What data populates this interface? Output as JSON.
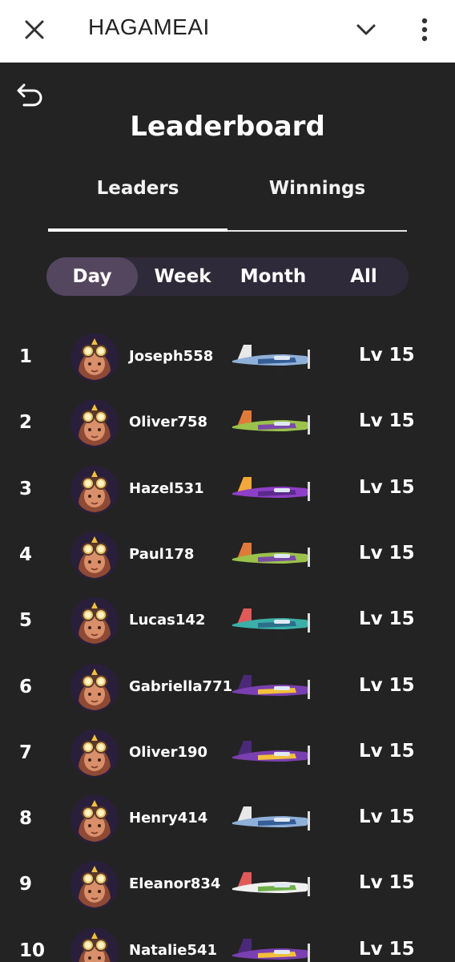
{
  "app_bar": {
    "title": "HAGAMEAI",
    "icons": {
      "close": "close-icon",
      "collapse": "chevron-down-icon",
      "more": "more-vertical-icon"
    }
  },
  "screen": {
    "back_icon": "back-arrow-icon",
    "title": "Leaderboard",
    "tabs": [
      {
        "label": "Leaders",
        "active": true
      },
      {
        "label": "Winnings",
        "active": false
      }
    ],
    "periods": [
      {
        "label": "Day",
        "active": true
      },
      {
        "label": "Week",
        "active": false
      },
      {
        "label": "Month",
        "active": false
      },
      {
        "label": "All",
        "active": false
      }
    ]
  },
  "colors": {
    "background": "#232323",
    "app_bar": "#ffffff",
    "period_bar": "#2f2a3a",
    "period_active": "#54465f"
  },
  "leaders": [
    {
      "rank": "1",
      "name": "Joseph558",
      "level": "Lv 15",
      "plane": "blue-biplane",
      "plane_colors": [
        "#8fb0d8",
        "#355d96",
        "#e8e8e8"
      ]
    },
    {
      "rank": "2",
      "name": "Oliver758",
      "level": "Lv 15",
      "plane": "green-purple-plane",
      "plane_colors": [
        "#9bc24a",
        "#7b4aa8",
        "#e07a3a"
      ]
    },
    {
      "rank": "3",
      "name": "Hazel531",
      "level": "Lv 15",
      "plane": "purple-jet",
      "plane_colors": [
        "#8e3fc7",
        "#5a2a8c",
        "#f2a83a"
      ]
    },
    {
      "rank": "4",
      "name": "Paul178",
      "level": "Lv 15",
      "plane": "green-purple-plane",
      "plane_colors": [
        "#9bc24a",
        "#7b4aa8",
        "#e07a3a"
      ]
    },
    {
      "rank": "5",
      "name": "Lucas142",
      "level": "Lv 15",
      "plane": "teal-biplane",
      "plane_colors": [
        "#3ab0a8",
        "#2b6e8a",
        "#e05a5a"
      ]
    },
    {
      "rank": "6",
      "name": "Gabriella771",
      "level": "Lv 15",
      "plane": "purple-yellow-plane",
      "plane_colors": [
        "#7a3fb0",
        "#f2c03a",
        "#4a2a78"
      ]
    },
    {
      "rank": "7",
      "name": "Oliver190",
      "level": "Lv 15",
      "plane": "purple-yellow-plane",
      "plane_colors": [
        "#7a3fb0",
        "#f2c03a",
        "#4a2a78"
      ]
    },
    {
      "rank": "8",
      "name": "Henry414",
      "level": "Lv 15",
      "plane": "blue-biplane",
      "plane_colors": [
        "#8fb0d8",
        "#355d96",
        "#e8e8e8"
      ]
    },
    {
      "rank": "9",
      "name": "Eleanor834",
      "level": "Lv 15",
      "plane": "white-green-plane",
      "plane_colors": [
        "#f0f0f0",
        "#6fb04a",
        "#e05a5a"
      ]
    },
    {
      "rank": "10",
      "name": "Natalie541",
      "level": "Lv 15",
      "plane": "purple-yellow-plane",
      "plane_colors": [
        "#7a3fb0",
        "#f2c03a",
        "#4a2a78"
      ]
    }
  ]
}
